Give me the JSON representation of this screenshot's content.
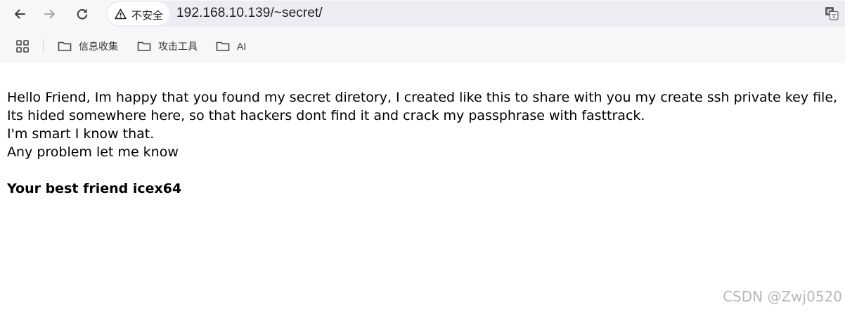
{
  "browser": {
    "security_label": "不安全",
    "url": "192.168.10.139/~secret/",
    "bookmarks": [
      {
        "label": "信息收集",
        "icon": "folder-icon"
      },
      {
        "label": "攻击工具",
        "icon": "folder-icon"
      },
      {
        "label": "AI",
        "icon": "folder-icon"
      }
    ]
  },
  "page": {
    "lines": [
      "Hello Friend, Im happy that you found my secret diretory, I created like this to share with you my create ssh private key file,",
      "Its hided somewhere here, so that hackers dont find it and crack my passphrase with fasttrack.",
      "I'm smart I know that.",
      "Any problem let me know"
    ],
    "signature": "Your best friend icex64"
  },
  "watermark": "CSDN @Zwj0520",
  "colors": {
    "toolbar_bg": "#f7f7fa",
    "omnibox_bg": "#ecedf2",
    "text": "#000000",
    "watermark": "#b8b8b8"
  }
}
